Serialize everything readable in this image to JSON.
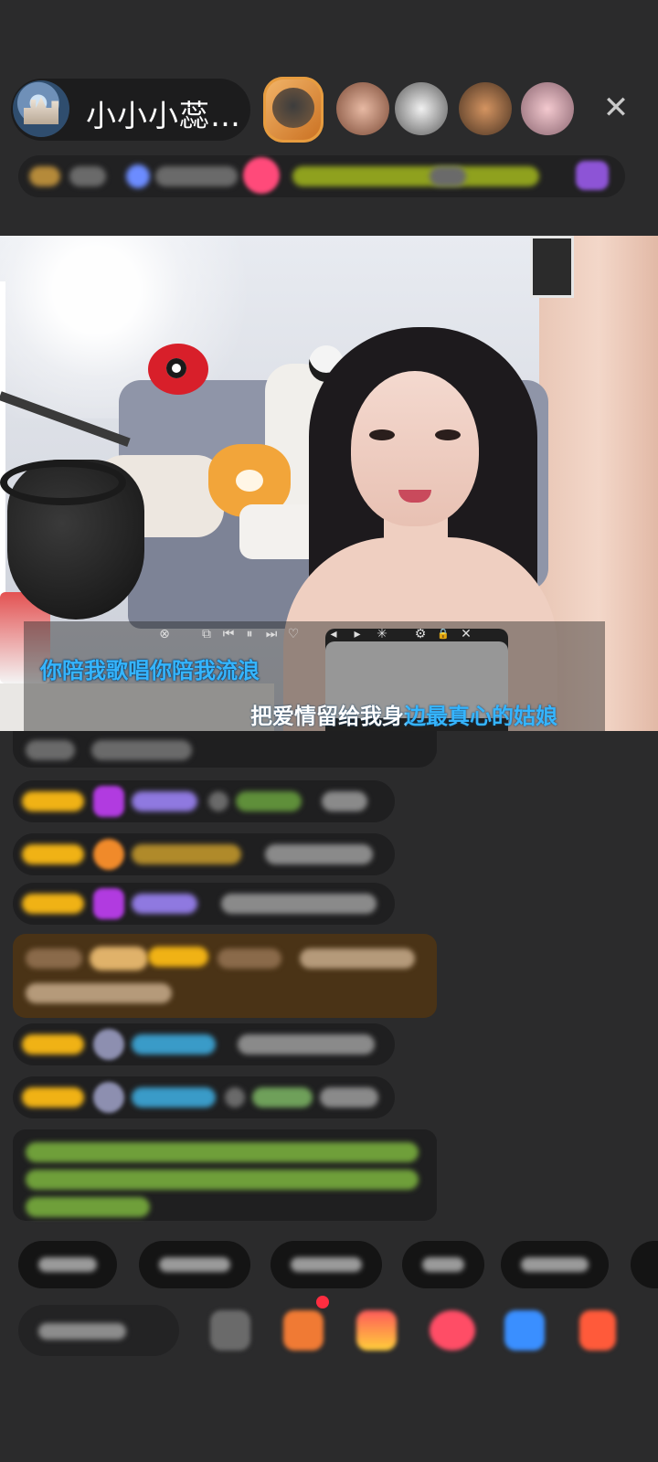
{
  "header": {
    "host_name": "小小小蕊…",
    "close_symbol": "✕"
  },
  "player": {
    "controls": [
      "⊗",
      "⧉",
      "⏮",
      "⏸",
      "⏭",
      "♡",
      "◂",
      "▸",
      "✳",
      "⚙",
      "🔒",
      "✕"
    ],
    "lyric_line_1": "你陪我歌唱你陪我流浪",
    "lyric_line_2": "把爱情留给我身边最真心的姑娘",
    "lyric_progress": 0.5
  },
  "colors": {
    "lyric_active": "#35b5ff",
    "badge": "#f0b215",
    "gift_bg": "#4a3316"
  },
  "icons": {
    "close": "close-icon",
    "diamond": "diamond-icon",
    "gift": "gift-icon",
    "share": "share-icon"
  }
}
